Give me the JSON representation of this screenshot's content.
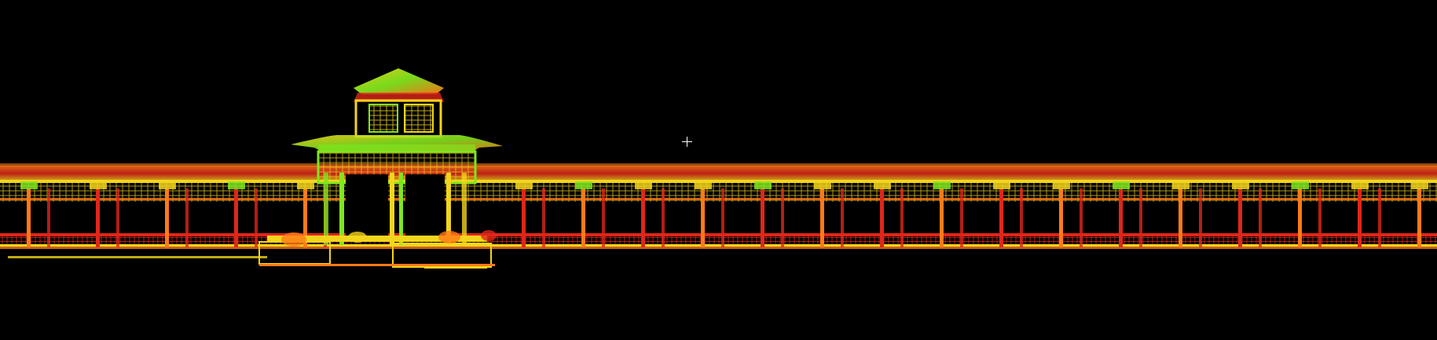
{
  "view": {
    "background": "#000000",
    "palette": {
      "red": "#e0261a",
      "orange": "#ff7a18",
      "yellow": "#f2d51c",
      "green": "#7fe61e",
      "crosshair": "#ffffff"
    }
  },
  "crosshair": {
    "icon": "crosshair-icon"
  }
}
